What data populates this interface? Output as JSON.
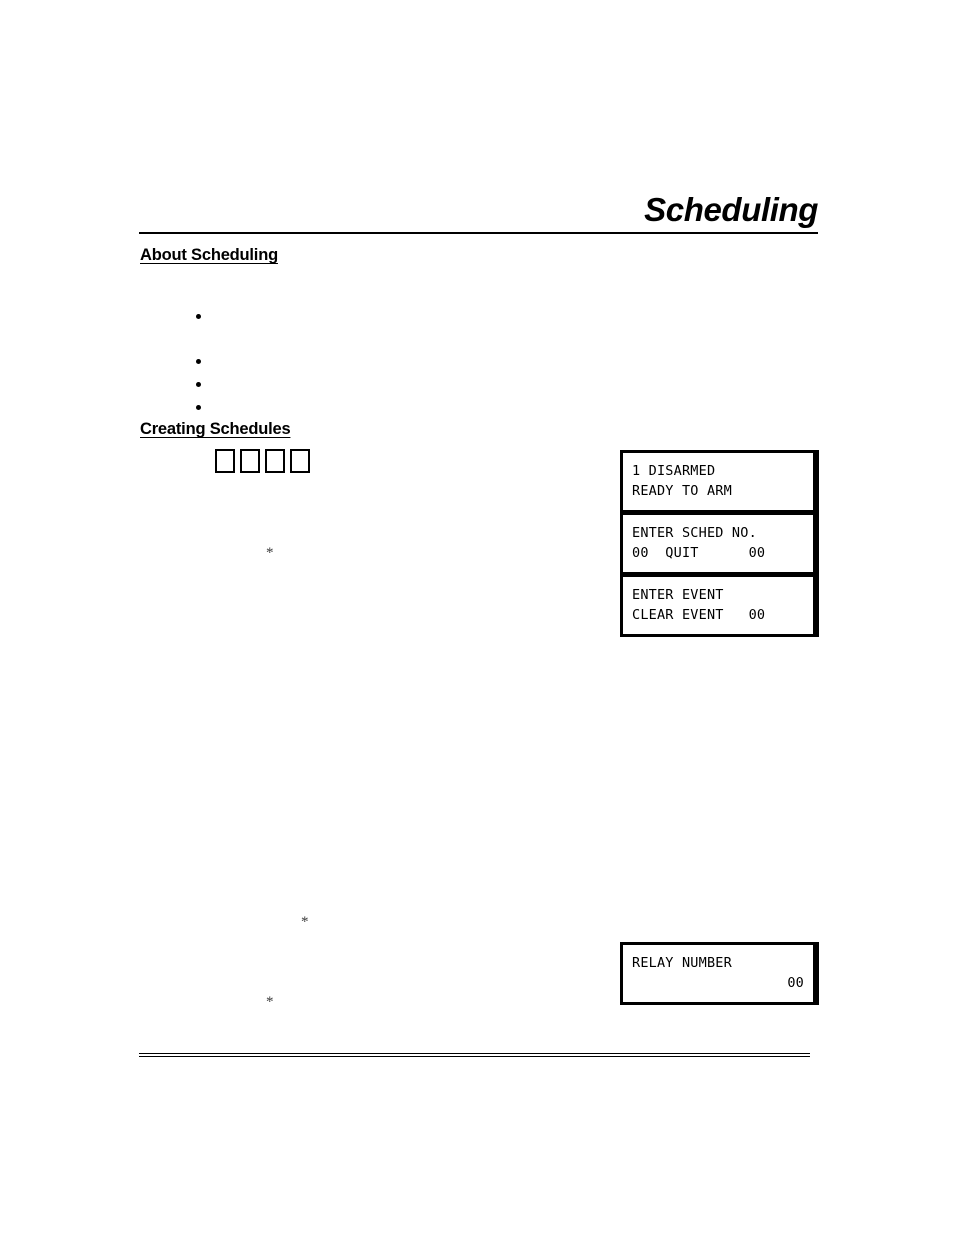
{
  "document": {
    "title": "Scheduling"
  },
  "sections": {
    "about": {
      "heading": "About Scheduling",
      "bullets": [
        "",
        "",
        "",
        ""
      ]
    },
    "creating": {
      "heading": "Creating Schedules",
      "keys": [
        "",
        "",
        "",
        ""
      ]
    }
  },
  "footnote_marks": {
    "mark_1": "*",
    "mark_2": "*",
    "mark_3": "*"
  },
  "lcd_displays": [
    {
      "name": "disarmed-status",
      "line1": "1 DISARMED",
      "line2": "READY TO ARM",
      "line2_align": "left"
    },
    {
      "name": "enter-schedule-number",
      "line1": "ENTER SCHED NO.",
      "line2": "00  QUIT      00",
      "line2_align": "left"
    },
    {
      "name": "enter-event",
      "line1": "ENTER EVENT",
      "line2": "CLEAR EVENT   00",
      "line2_align": "left"
    },
    {
      "name": "relay-number",
      "line1": "RELAY NUMBER",
      "line2": "00",
      "line2_align": "right"
    }
  ],
  "colors": {
    "ink": "#000000",
    "paper": "#ffffff",
    "footnote": "#3a3a3a"
  }
}
